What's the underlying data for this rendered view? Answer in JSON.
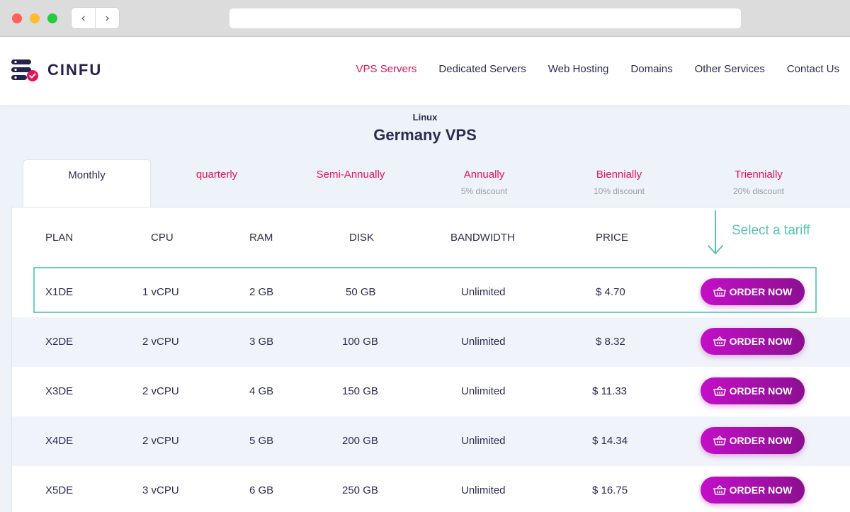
{
  "browser": {
    "back_icon": "chevron-left-icon",
    "forward_icon": "chevron-right-icon"
  },
  "brand": {
    "name": "CINFU",
    "colors": {
      "primary": "#23234e",
      "accent": "#e6135a",
      "button": "#b00fb8",
      "highlight": "#6fcfbf"
    }
  },
  "nav": {
    "items": [
      {
        "label": "VPS Servers",
        "active": true
      },
      {
        "label": "Dedicated Servers",
        "active": false
      },
      {
        "label": "Web Hosting",
        "active": false
      },
      {
        "label": "Domains",
        "active": false
      },
      {
        "label": "Other Services",
        "active": false
      },
      {
        "label": "Contact Us",
        "active": false
      }
    ]
  },
  "page": {
    "subtitle": "Linux",
    "title": "Germany VPS"
  },
  "tabs": [
    {
      "label": "Monthly",
      "discount": "",
      "active": true
    },
    {
      "label": "quarterly",
      "discount": "",
      "active": false
    },
    {
      "label": "Semi-Annually",
      "discount": "",
      "active": false
    },
    {
      "label": "Annually",
      "discount": "5% discount",
      "active": false
    },
    {
      "label": "Biennially",
      "discount": "10% discount",
      "active": false
    },
    {
      "label": "Triennially",
      "discount": "20% discount",
      "active": false
    }
  ],
  "table": {
    "headers": [
      "PLAN",
      "CPU",
      "RAM",
      "DISK",
      "BANDWIDTH",
      "PRICE"
    ],
    "order_label": "ORDER NOW",
    "order_icon": "basket-icon",
    "rows": [
      {
        "plan": "X1DE",
        "cpu": "1 vCPU",
        "ram": "2 GB",
        "disk": "50 GB",
        "bandwidth": "Unlimited",
        "price": "$ 4.70"
      },
      {
        "plan": "X2DE",
        "cpu": "2 vCPU",
        "ram": "3 GB",
        "disk": "100 GB",
        "bandwidth": "Unlimited",
        "price": "$ 8.32"
      },
      {
        "plan": "X3DE",
        "cpu": "2 vCPU",
        "ram": "4 GB",
        "disk": "150 GB",
        "bandwidth": "Unlimited",
        "price": "$ 11.33"
      },
      {
        "plan": "X4DE",
        "cpu": "2 vCPU",
        "ram": "5 GB",
        "disk": "200 GB",
        "bandwidth": "Unlimited",
        "price": "$ 14.34"
      },
      {
        "plan": "X5DE",
        "cpu": "3 vCPU",
        "ram": "6 GB",
        "disk": "250 GB",
        "bandwidth": "Unlimited",
        "price": "$ 16.75"
      }
    ]
  },
  "annotation": {
    "hint": "Select a tariff",
    "arrow_icon": "arrow-down-icon"
  }
}
